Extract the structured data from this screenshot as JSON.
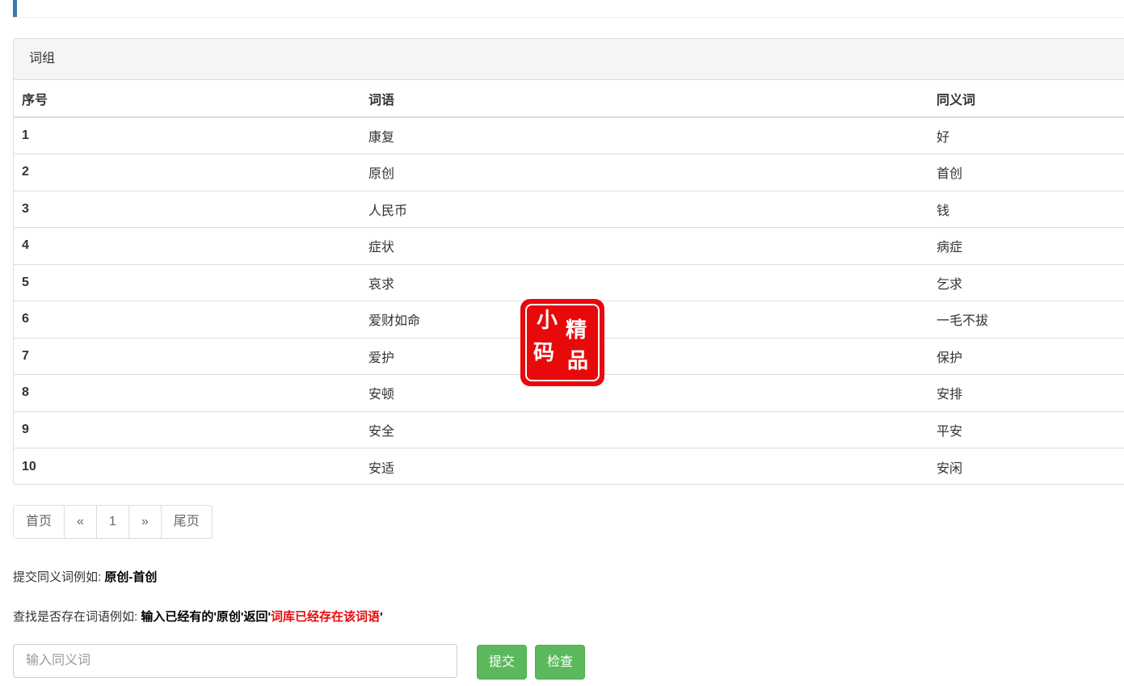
{
  "panel": {
    "heading": "词组",
    "columns": [
      "序号",
      "词语",
      "同义词"
    ],
    "rows": [
      {
        "id": "1",
        "word": "康复",
        "synonym": "好"
      },
      {
        "id": "2",
        "word": "原创",
        "synonym": "首创"
      },
      {
        "id": "3",
        "word": "人民币",
        "synonym": "钱"
      },
      {
        "id": "4",
        "word": "症状",
        "synonym": "病症"
      },
      {
        "id": "5",
        "word": "哀求",
        "synonym": "乞求"
      },
      {
        "id": "6",
        "word": "爱财如命",
        "synonym": "一毛不拔"
      },
      {
        "id": "7",
        "word": "爱护",
        "synonym": "保护"
      },
      {
        "id": "8",
        "word": "安顿",
        "synonym": "安排"
      },
      {
        "id": "9",
        "word": "安全",
        "synonym": "平安"
      },
      {
        "id": "10",
        "word": "安适",
        "synonym": "安闲"
      }
    ]
  },
  "watermark": {
    "chars": [
      "小",
      "码",
      "精",
      "品"
    ],
    "color": "#e8090b"
  },
  "pagination": {
    "first": "首页",
    "prev": "«",
    "current": "1",
    "next": "»",
    "last": "尾页"
  },
  "hints": {
    "submit_prefix": "提交同义词例如: ",
    "submit_example": "原创-首创",
    "check_prefix": "查找是否存在词语例如: ",
    "check_example": "输入已经有的'原创'返回'",
    "check_result": "词库已经存在该词语",
    "check_suffix": "'"
  },
  "form": {
    "placeholder": "输入同义词",
    "value": "",
    "submit_label": "提交",
    "check_label": "检查"
  },
  "colors": {
    "accent": "#337ab7",
    "success": "#5cb85c",
    "danger": "#e8090b"
  }
}
